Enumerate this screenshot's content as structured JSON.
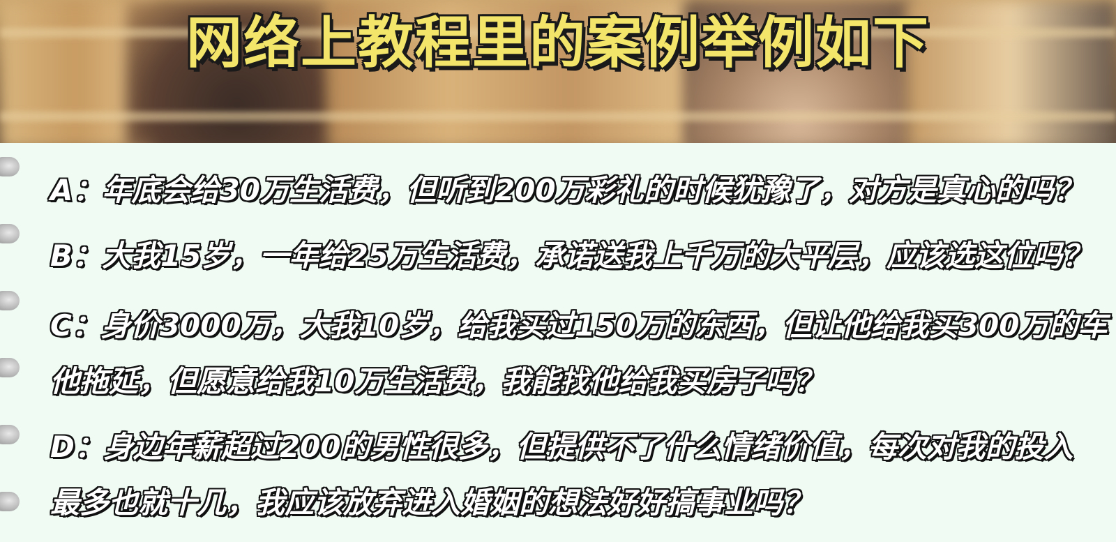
{
  "title": "网络上教程里的案例举例如下",
  "questions": [
    {
      "lines": [
        "A：年底会给30万生活费，但听到200万彩礼的时候犹豫了，对方是真心的吗？"
      ]
    },
    {
      "lines": [
        "B：大我15岁，一年给25万生活费，承诺送我上千万的大平层，应该选这位吗？"
      ]
    },
    {
      "lines": [
        "C：身价3000万，大我10岁，给我买过150万的东西，但让他给我买300万的车",
        "他拖延，但愿意给我10万生活费，我能找他给我买房子吗？"
      ]
    },
    {
      "lines": [
        "D：身边年薪超过200的男性很多，但提供不了什么情绪价值，每次对我的投入",
        "最多也就十几，我应该放弃进入婚姻的想法好好搞事业吗？"
      ]
    }
  ],
  "colors": {
    "title_fill": "#f2e56a",
    "title_outline": "#1a1a1a",
    "paper": "#f0fbf4",
    "question_fill": "#ffffff",
    "question_outline": "#111111"
  }
}
